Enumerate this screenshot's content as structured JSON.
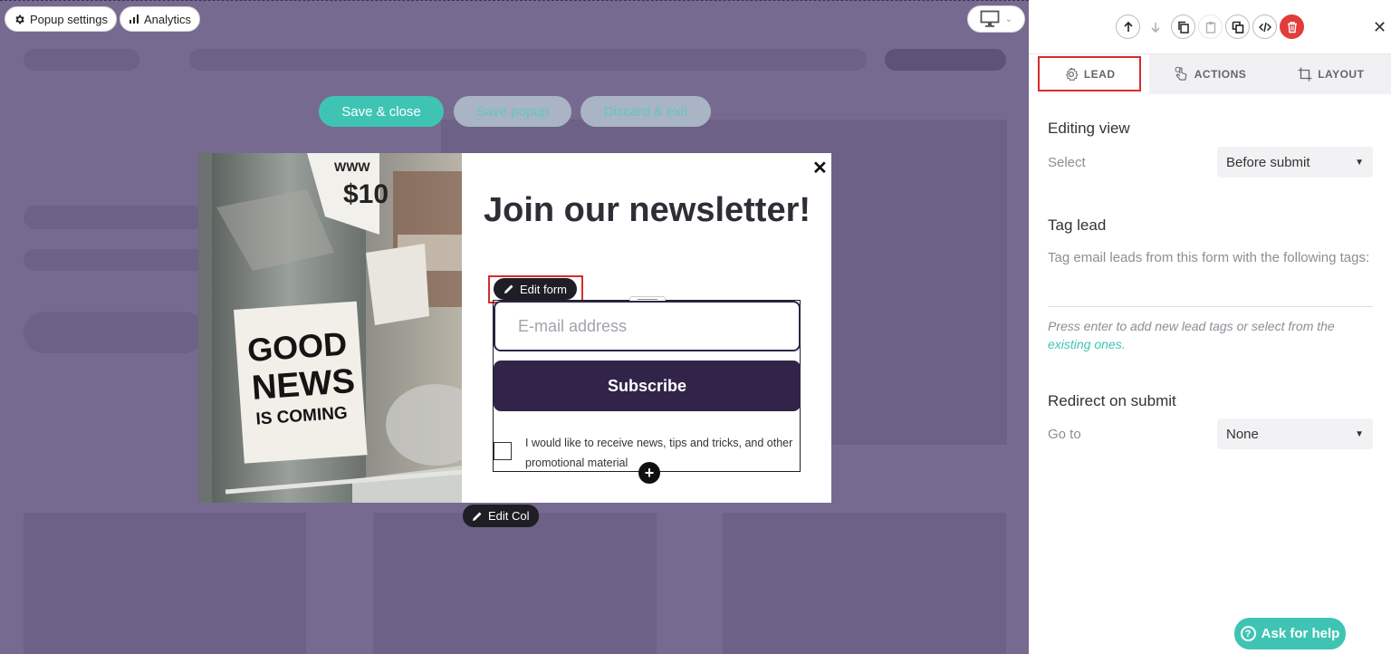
{
  "canvas": {
    "popup_settings_label": "Popup settings",
    "analytics_label": "Analytics",
    "save_close_label": "Save & close",
    "save_popup_label": "Save popup",
    "discard_exit_label": "Discard & exit"
  },
  "popup": {
    "title": "Join our newsletter!",
    "image_text": [
      "GOOD",
      "NEWS",
      "IS COMING"
    ],
    "edit_form_label": "Edit form",
    "email_placeholder": "E-mail address",
    "subscribe_label": "Subscribe",
    "consent_text": "I would like to receive news, tips and tricks, and other promotional material",
    "edit_col_label": "Edit Col"
  },
  "sidebar": {
    "tabs": [
      {
        "label": "LEAD",
        "icon": "gear-icon",
        "active": true
      },
      {
        "label": "ACTIONS",
        "icon": "hand-pointer-icon",
        "active": false
      },
      {
        "label": "LAYOUT",
        "icon": "crop-icon",
        "active": false
      }
    ],
    "editing_view": {
      "title": "Editing view",
      "label": "Select",
      "value": "Before submit"
    },
    "tag_lead": {
      "title": "Tag lead",
      "description": "Tag email leads from this form with the following tags:",
      "help_text": "Press enter to add new lead tags or select from the",
      "help_link": "existing ones."
    },
    "redirect": {
      "title": "Redirect on submit",
      "label": "Go to",
      "value": "None"
    },
    "help_label": "Ask for help"
  },
  "colors": {
    "accent": "#3fc4b4",
    "canvas_bg": "#776a90",
    "primary_dark": "#322449",
    "danger": "#e23b3b"
  }
}
